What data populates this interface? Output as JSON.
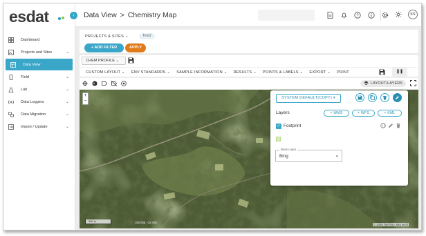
{
  "app": {
    "logo_text": "esdat",
    "collapse_icon": "chevron-left-icon"
  },
  "sidebar": {
    "items": [
      {
        "label": "Dashboard",
        "icon": "dashboard-icon",
        "has_chevron": false
      },
      {
        "label": "Projects and Sites",
        "icon": "folder-image-icon",
        "has_chevron": true
      },
      {
        "label": "Data View",
        "icon": "table-icon",
        "has_chevron": false,
        "active": true
      },
      {
        "label": "Field",
        "icon": "phone-icon",
        "has_chevron": true
      },
      {
        "label": "Lab",
        "icon": "flask-icon",
        "has_chevron": true
      },
      {
        "label": "Data Loggers",
        "icon": "signal-icon",
        "has_chevron": true
      },
      {
        "label": "Data Migration",
        "icon": "migration-icon",
        "has_chevron": true
      },
      {
        "label": "Import / Update",
        "icon": "import-icon",
        "has_chevron": true
      }
    ]
  },
  "header": {
    "breadcrumb": {
      "root": "Data View",
      "separator": ">",
      "current": "Chemistry Map"
    },
    "icons": [
      "document-icon",
      "bell-icon",
      "help-icon",
      "info-icon",
      "settings-icon"
    ],
    "theme_icon": "sun-icon",
    "avatar_initials": "KS"
  },
  "filters": {
    "projects_sites_label": "PROJECTS & SITES",
    "chip": "Test2",
    "add_filter": "+ ADD FILTER",
    "apply": "APPLY"
  },
  "toolbar": {
    "profile": "CHEM PROFILE",
    "menu": [
      "CUSTOM LAYOUT",
      "ENV STANDARDS",
      "SAMPLE INFORMATION",
      "RESULTS",
      "POINTS & LABELS",
      "EXPORT",
      "PRINT"
    ],
    "pause_icon": "pause-icon"
  },
  "map": {
    "tools": [
      "crosshair-icon",
      "globe-icon",
      "label-icon",
      "hide-label-icon",
      "target-icon"
    ],
    "layers_button": "LAYOUT/LAYERS",
    "zoom_in": "+",
    "zoom_out": "−",
    "scale": "300 m",
    "coords": "150.055, -33.409",
    "copyright": "© 2025 TomTom, Microsoft"
  },
  "layers_panel": {
    "style_select": "SYSTEM DEFAULT(COPY)",
    "actions": [
      "save-icon",
      "copy-icon",
      "delete-icon",
      "edit-icon"
    ],
    "title": "Layers",
    "add_buttons": [
      "+ WMS",
      "+ WFS",
      "+ KML"
    ],
    "layer_name": "Footprint",
    "layer_checked": true,
    "base_layer_label": "Base Layer",
    "base_layer_value": "Bing"
  },
  "colors": {
    "accent": "#3aa7c9",
    "apply": "#e07b1a",
    "background": "#ececec"
  }
}
